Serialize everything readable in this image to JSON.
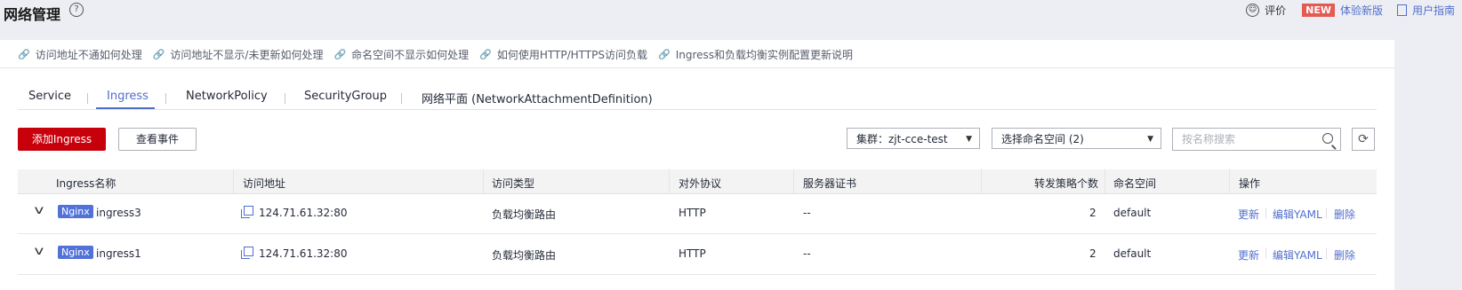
{
  "header": {
    "title": "网络管理",
    "help_icon": "question-circle-icon",
    "feedback_label": "评价",
    "new_badge": "NEW",
    "new_version_link": "体验新版",
    "guide_link": "用户指南"
  },
  "help_links": [
    {
      "label": "访问地址不通如何处理"
    },
    {
      "label": "访问地址不显示/未更新如何处理"
    },
    {
      "label": "命名空间不显示如何处理"
    },
    {
      "label": "如何使用HTTP/HTTPS访问负载"
    },
    {
      "label": "Ingress和负载均衡实例配置更新说明"
    }
  ],
  "tabs": [
    {
      "label": "Service"
    },
    {
      "label": "Ingress"
    },
    {
      "label": "NetworkPolicy"
    },
    {
      "label": "SecurityGroup"
    },
    {
      "label": "网络平面 (NetworkAttachmentDefinition)"
    }
  ],
  "active_tab": "Ingress",
  "toolbar": {
    "add_label": "添加Ingress",
    "events_label": "查看事件",
    "cluster_select": "集群：zjt-cce-test",
    "namespace_select": "选择命名空间 (2)",
    "search_placeholder": "按名称搜索"
  },
  "table": {
    "columns": [
      "Ingress名称",
      "访问地址",
      "访问类型",
      "对外协议",
      "服务器证书",
      "转发策略个数",
      "命名空间",
      "操作"
    ],
    "rows": [
      {
        "tag": "Nginx",
        "name": "ingress3",
        "address": "124.71.61.32:80",
        "type": "负载均衡路由",
        "protocol": "HTTP",
        "cert": "--",
        "rules": "2",
        "namespace": "default",
        "ops": [
          "更新",
          "编辑YAML",
          "删除"
        ]
      },
      {
        "tag": "Nginx",
        "name": "ingress1",
        "address": "124.71.61.32:80",
        "type": "负载均衡路由",
        "protocol": "HTTP",
        "cert": "--",
        "rules": "2",
        "namespace": "default",
        "ops": [
          "更新",
          "编辑YAML",
          "删除"
        ]
      }
    ]
  },
  "colors": {
    "brand_red": "#c7000b",
    "link_blue": "#526ecc",
    "tag_blue": "#5272d9",
    "badge_red": "#e45b53"
  }
}
